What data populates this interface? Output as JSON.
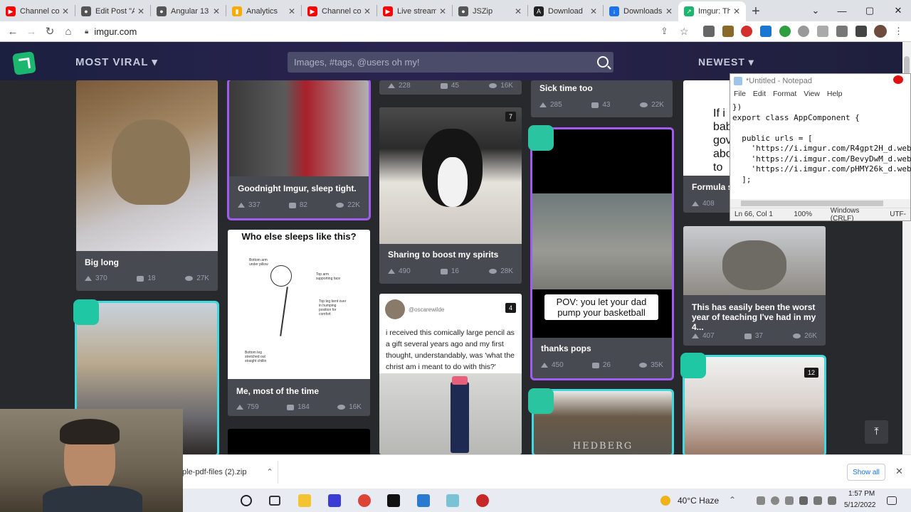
{
  "browser": {
    "tabs": [
      {
        "title": "Channel co",
        "icon": "youtube-icon",
        "color": "#ff0000"
      },
      {
        "title": "Edit Post \"A",
        "icon": "blogger-icon",
        "color": "#555555"
      },
      {
        "title": "Angular 13",
        "icon": "web-icon",
        "color": "#555555"
      },
      {
        "title": "Analytics",
        "icon": "analytics-icon",
        "color": "#f9ab00"
      },
      {
        "title": "Channel co",
        "icon": "youtube-icon",
        "color": "#ff0000"
      },
      {
        "title": "Live stream",
        "icon": "youtube-icon",
        "color": "#ff0000"
      },
      {
        "title": "JSZip",
        "icon": "web-icon",
        "color": "#555555"
      },
      {
        "title": "Download",
        "icon": "a-icon",
        "color": "#222222"
      },
      {
        "title": "Downloads",
        "icon": "download-icon",
        "color": "#1a73e8"
      },
      {
        "title": "Imgur: The",
        "icon": "imgur-icon",
        "color": "#1bb76e",
        "active": true
      }
    ],
    "url": "imgur.com"
  },
  "imgur": {
    "sort_label": "MOST VIRAL",
    "search_placeholder": "Images, #tags, @users oh my!",
    "newest_label": "NEWEST",
    "posts": [
      {
        "title": "",
        "up": "228",
        "comments": "45",
        "views": "16K"
      },
      {
        "title": "Sick time too",
        "up": "285",
        "comments": "43",
        "views": "22K"
      },
      {
        "title": "Goodnight Imgur, sleep tight.",
        "up": "337",
        "comments": "82",
        "views": "22K"
      },
      {
        "title": "Big long",
        "up": "370",
        "comments": "18",
        "views": "27K"
      },
      {
        "title": "Sharing to boost my spirits",
        "up": "490",
        "comments": "16",
        "views": "28K",
        "badge": "7"
      },
      {
        "title": "thanks pops",
        "up": "450",
        "comments": "26",
        "views": "35K",
        "caption": "POV: you let your dad pump your basketball"
      },
      {
        "title": "Formula sh",
        "up": "408"
      },
      {
        "title": "This has easily been the worst year of teaching I've had in my 4...",
        "up": "407",
        "comments": "37",
        "views": "26K"
      },
      {
        "title": "Me, most of the time",
        "up": "759",
        "comments": "184",
        "views": "16K",
        "header": "Who else sleeps like this?"
      },
      {
        "title": "",
        "badge": "4",
        "user": "@oscarewilde",
        "tweet": "i received this comically large pencil as a gift several years ago and my first thought, understandably, was 'what the christ am i meant to do with this?'"
      },
      {
        "title": "",
        "badge": "12"
      }
    ],
    "meme_partial": [
      "If i",
      "babie",
      "gove",
      "about",
      "to"
    ],
    "grave_text": "HEDBERG",
    "sketch_labels": [
      "Bottom arm under pillow",
      "Top arm supporting face",
      "Top leg bent over in humping position for comfort",
      "Bottom leg stretched out straight chillin"
    ]
  },
  "notepad": {
    "title": "*Untitled - Notepad",
    "menu": [
      "File",
      "Edit",
      "Format",
      "View",
      "Help"
    ],
    "code": "})\nexport class AppComponent {\n\n  public urls = [\n    'https://i.imgur.com/R4gpt2H_d.web\n    'https://i.imgur.com/BevyDwM_d.web\n    'https://i.imgur.com/pHMY26k_d.web\n  ];",
    "status": [
      "Ln 66, Col 1",
      "100%",
      "Windows (CRLF)",
      "UTF-"
    ]
  },
  "downloads": {
    "file": "ple-pdf-files (2).zip",
    "show_all": "Show all"
  },
  "taskbar": {
    "weather": "40°C  Haze",
    "time": "1:57 PM",
    "date": "5/12/2022"
  }
}
